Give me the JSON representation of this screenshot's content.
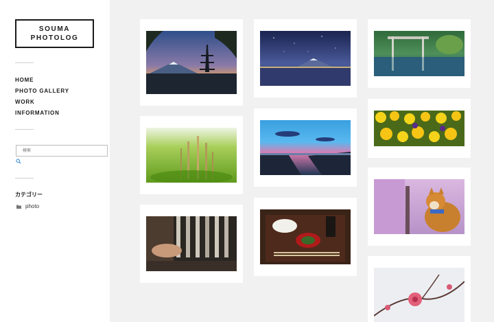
{
  "site": {
    "title_line1": "SOUMA",
    "title_line2": "PHOTOLOG"
  },
  "nav": {
    "items": [
      {
        "label": "HOME"
      },
      {
        "label": "PHOTO GALLERY"
      },
      {
        "label": "WORK"
      },
      {
        "label": "INFORMATION"
      }
    ]
  },
  "search": {
    "placeholder": "検索",
    "icon": "search-icon"
  },
  "categories": {
    "title": "カテゴリー",
    "items": [
      {
        "label": "photo",
        "icon": "folder-icon"
      }
    ]
  },
  "colors": {
    "background": "#f1f1f1",
    "sidebar": "#ffffff",
    "text": "#1a1a1a",
    "search_icon": "#3a8fd9"
  },
  "gallery": {
    "photos": [
      {
        "subject": "mount-fuji-pagoda-sunset"
      },
      {
        "subject": "mount-fuji-night-sky-lake"
      },
      {
        "subject": "torii-gate-reflection-green"
      },
      {
        "subject": "green-grass-sprouts-closeup"
      },
      {
        "subject": "blue-sky-shore-dusk"
      },
      {
        "subject": "yellow-pansy-flowers"
      },
      {
        "subject": "kitchen-hands-pouring"
      },
      {
        "subject": "japanese-meal-tray"
      },
      {
        "subject": "shiba-dog-cherry-blossoms"
      },
      {
        "subject": "plum-blossom-pink"
      }
    ]
  }
}
